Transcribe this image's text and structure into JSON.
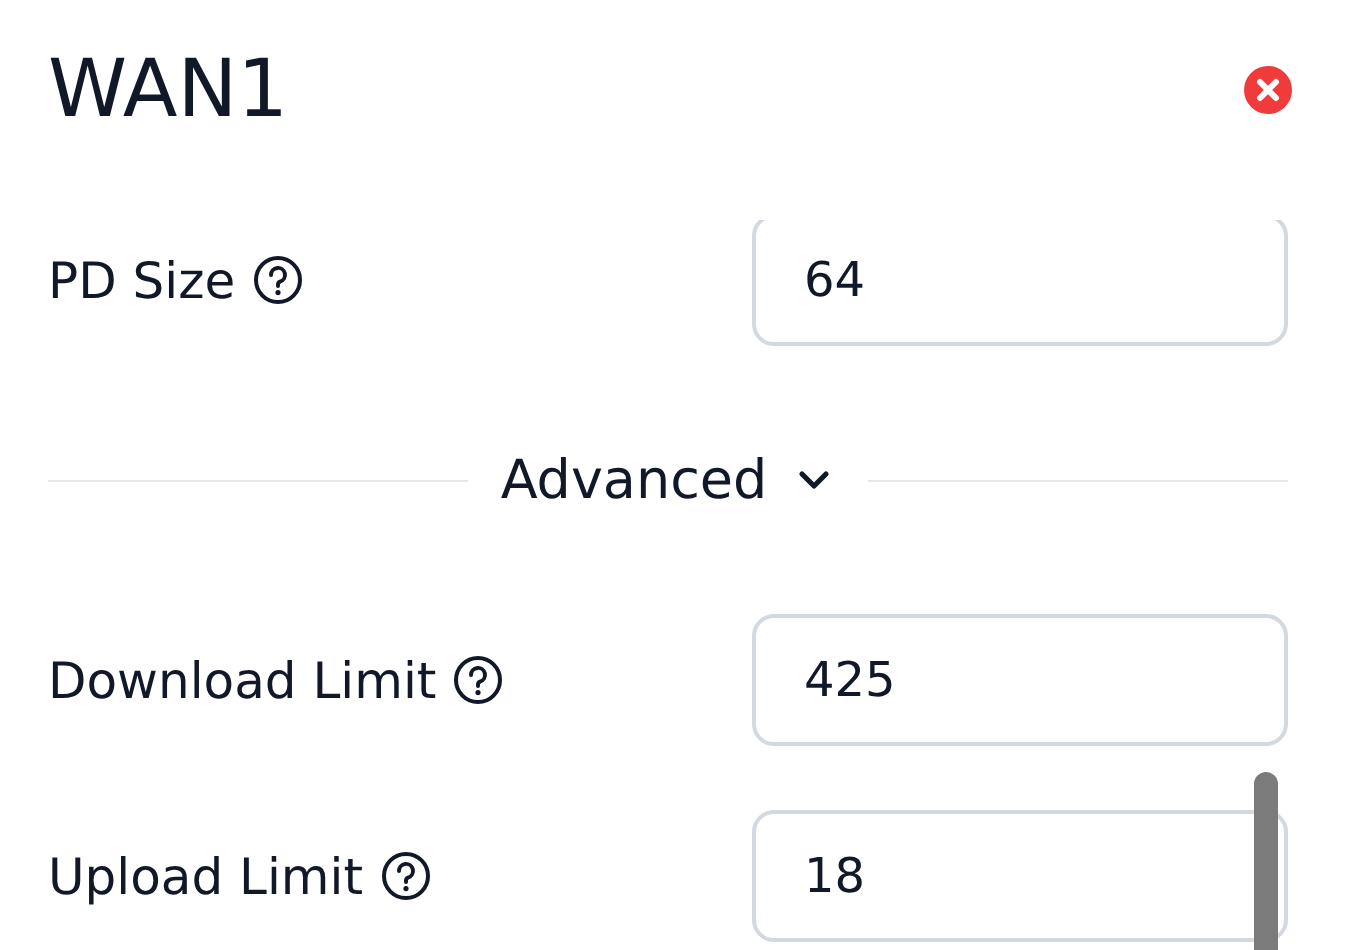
{
  "dialog": {
    "title": "WAN1"
  },
  "fields": [
    {
      "label": "PD Size",
      "value": "64"
    }
  ],
  "advanced": {
    "label": "Advanced",
    "expanded": true,
    "fields": [
      {
        "label": "Download Limit",
        "value": "425"
      },
      {
        "label": "Upload Limit",
        "value": "18"
      }
    ]
  }
}
